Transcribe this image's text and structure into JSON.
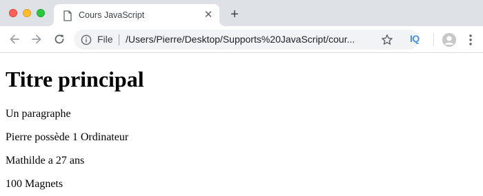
{
  "window": {
    "controls": {
      "close_color": "#fe5f57",
      "minimize_color": "#febc2e",
      "maximize_color": "#28c840"
    }
  },
  "tab": {
    "title": "Cours JavaScript",
    "icon": "document-icon",
    "close_glyph": "✕"
  },
  "new_tab_glyph": "+",
  "toolbar": {
    "icons": [
      "back-icon",
      "forward-icon",
      "reload-icon",
      "star-icon",
      "menu-icon"
    ],
    "site_info_label": "File",
    "url": "/Users/Pierre/Desktop/Supports%20JavaScript/cour...",
    "extension_label": "IQ",
    "extension_color": "#4a90e2"
  },
  "page": {
    "heading": "Titre principal",
    "paragraphs": [
      "Un paragraphe",
      "Pierre possède 1 Ordinateur",
      "Mathilde a 27 ans",
      "100 Magnets"
    ]
  }
}
